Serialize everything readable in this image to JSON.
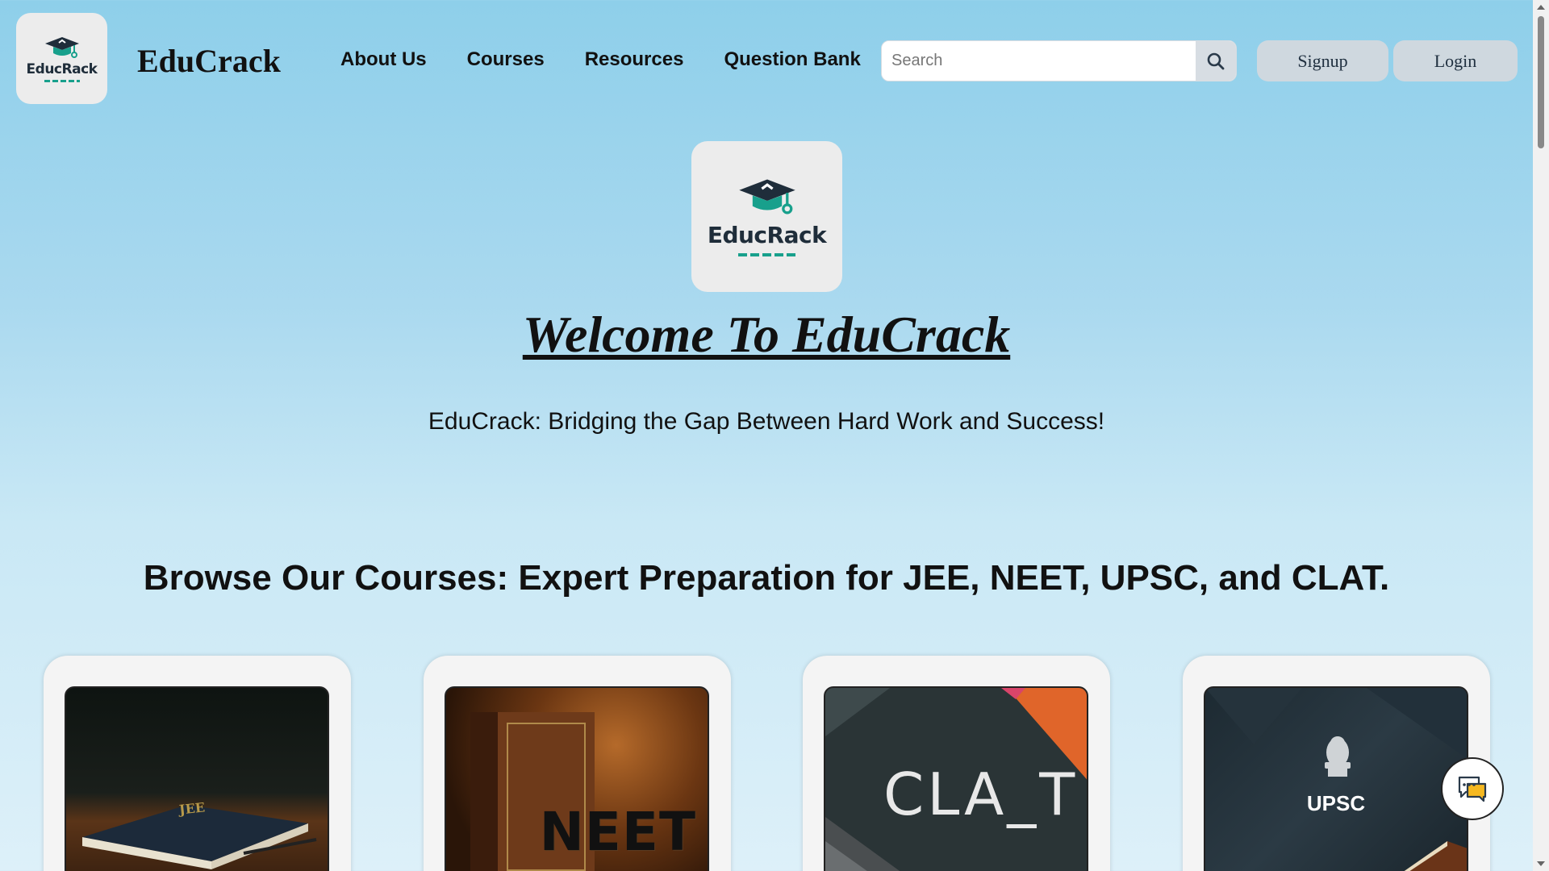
{
  "header": {
    "logo_text": "EducRack",
    "brand": "EduCrack",
    "nav": [
      "About Us",
      "Courses",
      "Resources",
      "Question Bank"
    ],
    "search": {
      "placeholder": "Search",
      "value": ""
    },
    "signup_label": "Signup",
    "login_label": "Login"
  },
  "hero": {
    "logo_text": "EducRack",
    "title": "Welcome To EduCrack",
    "tagline": "EduCrack: Bridging the Gap Between Hard Work and Success!"
  },
  "courses": {
    "heading": "Browse Our Courses: Expert Preparation for JEE, NEET, UPSC, and CLAT.",
    "cards": [
      {
        "image_text": "JEE"
      },
      {
        "image_text": "NEET"
      },
      {
        "image_text": "CLA_T"
      },
      {
        "image_text": "UPSC"
      }
    ]
  },
  "icons": {
    "search": "search-icon",
    "chat": "chat-icon",
    "graduation_cap": "graduation-cap-icon"
  },
  "colors": {
    "background_top": "#8ecfea",
    "background_bottom": "#ddf0f9",
    "accent": "#18a08c",
    "button_bg": "#cfd8df"
  }
}
